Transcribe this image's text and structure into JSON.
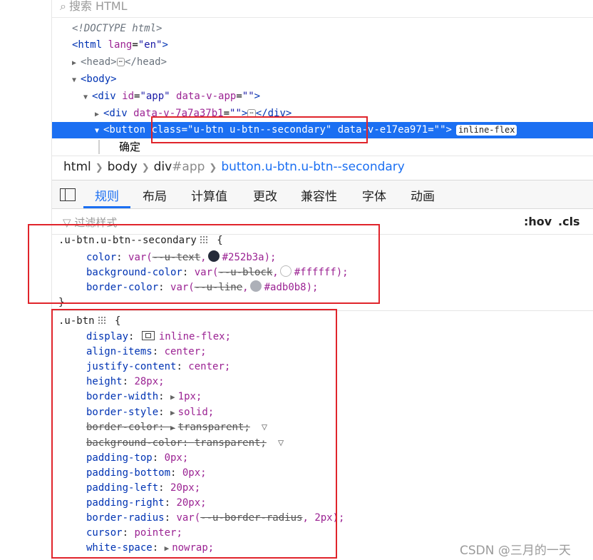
{
  "search": {
    "placeholder": "搜索 HTML"
  },
  "dom_tree": {
    "doctype": "<!DOCTYPE html>",
    "html_open": "<html",
    "html_attr": "lang",
    "html_val": "\"en\"",
    "head_open": "<head>",
    "head_close": "</head>",
    "body_open": "<body>",
    "div_app_open": "<div",
    "div_app_attr1": "id",
    "div_app_val1": "\"app\"",
    "div_app_attr2": "data-v-app",
    "div_app_val2": "\"\"",
    "div2_open": "<div",
    "div2_attr": "data-v-7a7a37b1",
    "div2_val": "\"\"",
    "div2_close": "</div>",
    "button_open": "<button",
    "button_attr1": "class",
    "button_val1": "\"u-btn u-btn--secondary\"",
    "button_attr2": "data-v-e17ea971",
    "button_val2": "\"\"",
    "button_badge": "inline-flex",
    "button_text": "确定"
  },
  "breadcrumb": {
    "items": [
      "html",
      "body",
      "div",
      "#app",
      "button.u-btn.u-btn--secondary"
    ]
  },
  "tabs": [
    "规则",
    "布局",
    "计算值",
    "更改",
    "兼容性",
    "字体",
    "动画"
  ],
  "filter": {
    "placeholder": "过滤样式",
    "hov": ":hov",
    "cls": ".cls"
  },
  "rule1": {
    "selector": ".u-btn.u-btn--secondary",
    "decls": [
      {
        "prop": "color",
        "fn": "var(",
        "varname": "--u-text",
        "swatch": "#252b3a",
        "value": "#252b3a);"
      },
      {
        "prop": "background-color",
        "fn": "var(",
        "varname": "--u-block",
        "swatch": "#ffffff",
        "value": "#ffffff);"
      },
      {
        "prop": "border-color",
        "fn": "var(",
        "varname": "--u-line",
        "swatch": "#adb0b8",
        "value": "#adb0b8);"
      }
    ],
    "close": "}"
  },
  "rule2": {
    "selector": ".u-btn",
    "decls": [
      {
        "prop": "display",
        "value": "inline-flex;"
      },
      {
        "prop": "align-items",
        "value": "center;"
      },
      {
        "prop": "justify-content",
        "value": "center;"
      },
      {
        "prop": "height",
        "value": "28px;"
      },
      {
        "prop": "border-width",
        "value": "1px;"
      },
      {
        "prop": "border-style",
        "value": "solid;"
      },
      {
        "prop": "border-color",
        "value": "transparent;"
      },
      {
        "prop": "background-color",
        "value": "transparent;"
      },
      {
        "prop": "padding-top",
        "value": "0px;"
      },
      {
        "prop": "padding-bottom",
        "value": "0px;"
      },
      {
        "prop": "padding-left",
        "value": "20px;"
      },
      {
        "prop": "padding-right",
        "value": "20px;"
      },
      {
        "prop": "border-radius",
        "fn": "var(",
        "varname": "--u-border-radius",
        "value": "2px);"
      },
      {
        "prop": "cursor",
        "value": "pointer;"
      },
      {
        "prop": "white-space",
        "value": "nowrap;"
      }
    ]
  },
  "watermark": "CSDN @三月的一天",
  "colors": {
    "accent": "#1b6ff2",
    "highlight_box": "#e0242b"
  }
}
